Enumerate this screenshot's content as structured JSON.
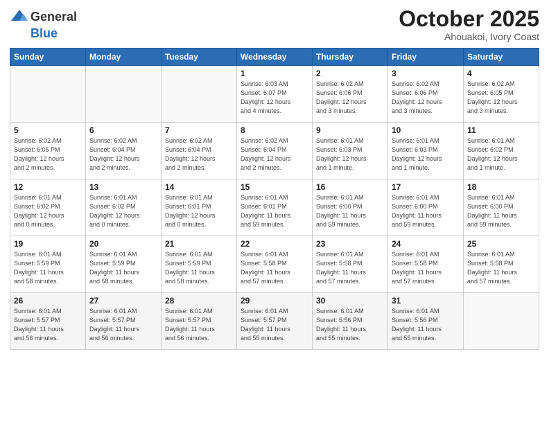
{
  "logo": {
    "general": "General",
    "blue": "Blue"
  },
  "title": "October 2025",
  "location": "Ahouakoi, Ivory Coast",
  "weekdays": [
    "Sunday",
    "Monday",
    "Tuesday",
    "Wednesday",
    "Thursday",
    "Friday",
    "Saturday"
  ],
  "weeks": [
    [
      {
        "day": "",
        "info": ""
      },
      {
        "day": "",
        "info": ""
      },
      {
        "day": "",
        "info": ""
      },
      {
        "day": "1",
        "info": "Sunrise: 6:03 AM\nSunset: 6:07 PM\nDaylight: 12 hours\nand 4 minutes."
      },
      {
        "day": "2",
        "info": "Sunrise: 6:02 AM\nSunset: 6:06 PM\nDaylight: 12 hours\nand 3 minutes."
      },
      {
        "day": "3",
        "info": "Sunrise: 6:02 AM\nSunset: 6:06 PM\nDaylight: 12 hours\nand 3 minutes."
      },
      {
        "day": "4",
        "info": "Sunrise: 6:02 AM\nSunset: 6:05 PM\nDaylight: 12 hours\nand 3 minutes."
      }
    ],
    [
      {
        "day": "5",
        "info": "Sunrise: 6:02 AM\nSunset: 6:05 PM\nDaylight: 12 hours\nand 2 minutes."
      },
      {
        "day": "6",
        "info": "Sunrise: 6:02 AM\nSunset: 6:04 PM\nDaylight: 12 hours\nand 2 minutes."
      },
      {
        "day": "7",
        "info": "Sunrise: 6:02 AM\nSunset: 6:04 PM\nDaylight: 12 hours\nand 2 minutes."
      },
      {
        "day": "8",
        "info": "Sunrise: 6:02 AM\nSunset: 6:04 PM\nDaylight: 12 hours\nand 2 minutes."
      },
      {
        "day": "9",
        "info": "Sunrise: 6:01 AM\nSunset: 6:03 PM\nDaylight: 12 hours\nand 1 minute."
      },
      {
        "day": "10",
        "info": "Sunrise: 6:01 AM\nSunset: 6:03 PM\nDaylight: 12 hours\nand 1 minute."
      },
      {
        "day": "11",
        "info": "Sunrise: 6:01 AM\nSunset: 6:02 PM\nDaylight: 12 hours\nand 1 minute."
      }
    ],
    [
      {
        "day": "12",
        "info": "Sunrise: 6:01 AM\nSunset: 6:02 PM\nDaylight: 12 hours\nand 0 minutes."
      },
      {
        "day": "13",
        "info": "Sunrise: 6:01 AM\nSunset: 6:02 PM\nDaylight: 12 hours\nand 0 minutes."
      },
      {
        "day": "14",
        "info": "Sunrise: 6:01 AM\nSunset: 6:01 PM\nDaylight: 12 hours\nand 0 minutes."
      },
      {
        "day": "15",
        "info": "Sunrise: 6:01 AM\nSunset: 6:01 PM\nDaylight: 11 hours\nand 59 minutes."
      },
      {
        "day": "16",
        "info": "Sunrise: 6:01 AM\nSunset: 6:00 PM\nDaylight: 11 hours\nand 59 minutes."
      },
      {
        "day": "17",
        "info": "Sunrise: 6:01 AM\nSunset: 6:00 PM\nDaylight: 11 hours\nand 59 minutes."
      },
      {
        "day": "18",
        "info": "Sunrise: 6:01 AM\nSunset: 6:00 PM\nDaylight: 11 hours\nand 59 minutes."
      }
    ],
    [
      {
        "day": "19",
        "info": "Sunrise: 6:01 AM\nSunset: 5:59 PM\nDaylight: 11 hours\nand 58 minutes."
      },
      {
        "day": "20",
        "info": "Sunrise: 6:01 AM\nSunset: 5:59 PM\nDaylight: 11 hours\nand 58 minutes."
      },
      {
        "day": "21",
        "info": "Sunrise: 6:01 AM\nSunset: 5:59 PM\nDaylight: 11 hours\nand 58 minutes."
      },
      {
        "day": "22",
        "info": "Sunrise: 6:01 AM\nSunset: 5:58 PM\nDaylight: 11 hours\nand 57 minutes."
      },
      {
        "day": "23",
        "info": "Sunrise: 6:01 AM\nSunset: 5:58 PM\nDaylight: 11 hours\nand 57 minutes."
      },
      {
        "day": "24",
        "info": "Sunrise: 6:01 AM\nSunset: 5:58 PM\nDaylight: 11 hours\nand 57 minutes."
      },
      {
        "day": "25",
        "info": "Sunrise: 6:01 AM\nSunset: 5:58 PM\nDaylight: 11 hours\nand 57 minutes."
      }
    ],
    [
      {
        "day": "26",
        "info": "Sunrise: 6:01 AM\nSunset: 5:57 PM\nDaylight: 11 hours\nand 56 minutes."
      },
      {
        "day": "27",
        "info": "Sunrise: 6:01 AM\nSunset: 5:57 PM\nDaylight: 11 hours\nand 56 minutes."
      },
      {
        "day": "28",
        "info": "Sunrise: 6:01 AM\nSunset: 5:57 PM\nDaylight: 11 hours\nand 56 minutes."
      },
      {
        "day": "29",
        "info": "Sunrise: 6:01 AM\nSunset: 5:57 PM\nDaylight: 11 hours\nand 55 minutes."
      },
      {
        "day": "30",
        "info": "Sunrise: 6:01 AM\nSunset: 5:56 PM\nDaylight: 11 hours\nand 55 minutes."
      },
      {
        "day": "31",
        "info": "Sunrise: 6:01 AM\nSunset: 5:56 PM\nDaylight: 11 hours\nand 55 minutes."
      },
      {
        "day": "",
        "info": ""
      }
    ]
  ]
}
